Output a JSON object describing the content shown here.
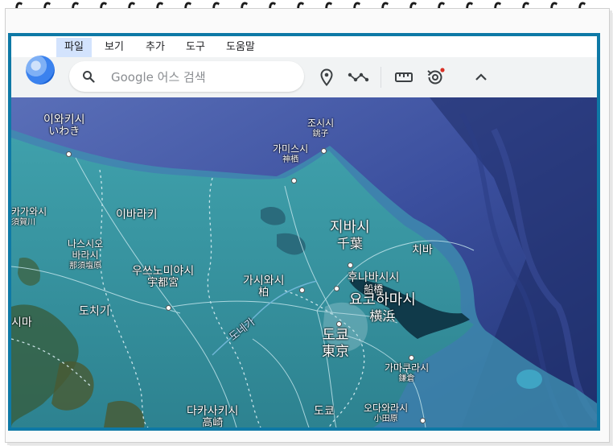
{
  "menu": {
    "items": [
      "파일",
      "보기",
      "추가",
      "도구",
      "도움말"
    ],
    "active": "파일"
  },
  "search": {
    "placeholder": "Google 어스 검색"
  },
  "toolbar": {
    "icons": [
      "pin-icon",
      "path-icon",
      "ruler-icon",
      "history-icon",
      "chevron-up-icon"
    ],
    "notification_color": "#d93025"
  },
  "map": {
    "labels": {
      "iwaki": "이와키시",
      "iwaki_native": "いわき",
      "choshi": "조시시",
      "choshi_native": "銚子",
      "kamisu": "가미스시",
      "kamisu_native": "神栖",
      "sukagawa": "카가와시",
      "sukagawa_native": "須賀川",
      "ibaraki": "이바라키",
      "chiba_pref": "지바시",
      "chiba_pref_native": "千葉",
      "chiba": "치바",
      "nasushiobara": "나스시오",
      "nasushiobara_2": "바라시",
      "nasushiobara_native": "那須塩原",
      "utsunomiya": "우쓰노미야시",
      "utsunomiya_native": "宇都宮",
      "kashiwa": "가시와시",
      "kashiwa_native": "柏",
      "funabashi": "후나바시시",
      "funabashi_native": "船橋",
      "yokohama": "요코하마시",
      "yokohama_native": "横浜",
      "tochigi": "도치기",
      "tone_river": "도네가",
      "tokyo": "도쿄",
      "tokyo_native": "東京",
      "kamakura": "가마쿠라시",
      "kamakura_native": "鎌倉",
      "ima_cut": "시마",
      "takasaki": "다카사키시",
      "takasaki_native": "高崎",
      "tokyo_bottom": "도쿄",
      "odawara": "오다와라시",
      "odawara_native": "小田原"
    }
  }
}
